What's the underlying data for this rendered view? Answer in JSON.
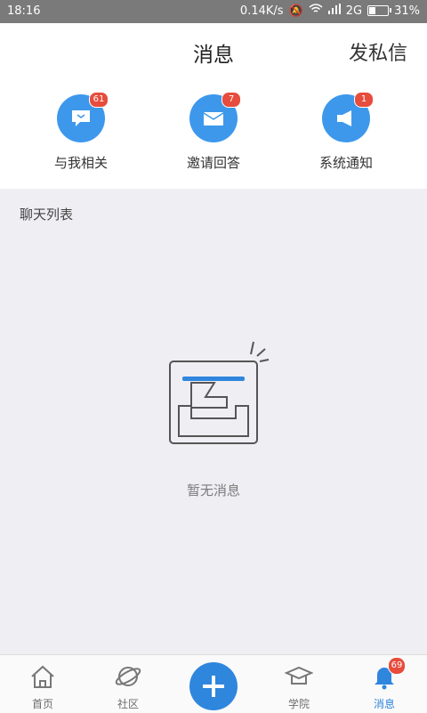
{
  "status": {
    "time": "18:16",
    "net_speed": "0.14K/s",
    "signal": "2G",
    "battery": "31%"
  },
  "header": {
    "title": "消息",
    "dm": "发私信"
  },
  "shortcuts": [
    {
      "label": "与我相关",
      "badge": "61",
      "icon": "chat-bubble-icon"
    },
    {
      "label": "邀请回答",
      "badge": "7",
      "icon": "envelope-icon"
    },
    {
      "label": "系统通知",
      "badge": "1",
      "icon": "megaphone-icon"
    }
  ],
  "section": {
    "title": "聊天列表"
  },
  "empty": {
    "text": "暂无消息"
  },
  "tabs": [
    {
      "label": "首页",
      "icon": "home-icon"
    },
    {
      "label": "社区",
      "icon": "planet-icon"
    },
    {
      "label": "",
      "icon": "plus-icon"
    },
    {
      "label": "学院",
      "icon": "graduation-cap-icon"
    },
    {
      "label": "消息",
      "icon": "bell-icon",
      "badge": "69"
    }
  ],
  "colors": {
    "accent": "#2f86dd",
    "badge": "#e74c3c",
    "icon_bg": "#3d98ec"
  }
}
